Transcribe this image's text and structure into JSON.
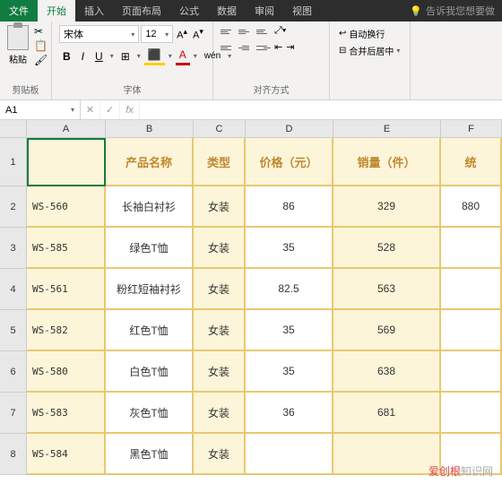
{
  "tabs": {
    "file": "文件",
    "home": "开始",
    "insert": "插入",
    "layout": "页面布局",
    "formulas": "公式",
    "data": "数据",
    "review": "审阅",
    "view": "视图",
    "tellme": "告诉我您想要做"
  },
  "ribbon": {
    "paste": "粘贴",
    "clipboard": "剪贴板",
    "font_name": "宋体",
    "font_size": "12",
    "bold": "B",
    "italic": "I",
    "underline": "U",
    "wen": "wén",
    "font": "字体",
    "wrap": "自动换行",
    "merge": "合并后居中",
    "align": "对齐方式"
  },
  "formula_bar": {
    "name": "A1",
    "fx": "fx"
  },
  "columns": [
    "A",
    "B",
    "C",
    "D",
    "E",
    "F"
  ],
  "rows": [
    "1",
    "2",
    "3",
    "4",
    "5",
    "6",
    "7",
    "8"
  ],
  "headers": {
    "a": "",
    "b": "产品名称",
    "c": "类型",
    "d": "价格（元）",
    "e": "销量（件）",
    "f": "统"
  },
  "data": [
    {
      "a": "WS-560",
      "b": "长袖白衬衫",
      "c": "女装",
      "d": "86",
      "e": "329",
      "f": "880"
    },
    {
      "a": "WS-585",
      "b": "绿色T恤",
      "c": "女装",
      "d": "35",
      "e": "528",
      "f": ""
    },
    {
      "a": "WS-561",
      "b": "粉红短袖衬衫",
      "c": "女装",
      "d": "82.5",
      "e": "563",
      "f": ""
    },
    {
      "a": "WS-582",
      "b": "红色T恤",
      "c": "女装",
      "d": "35",
      "e": "569",
      "f": ""
    },
    {
      "a": "WS-580",
      "b": "白色T恤",
      "c": "女装",
      "d": "35",
      "e": "638",
      "f": ""
    },
    {
      "a": "WS-583",
      "b": "灰色T恤",
      "c": "女装",
      "d": "36",
      "e": "681",
      "f": ""
    },
    {
      "a": "WS-584",
      "b": "黑色T恤",
      "c": "女装",
      "d": "",
      "e": "",
      "f": ""
    }
  ],
  "watermark": {
    "brand": "爱创根",
    "rest": "知识网"
  }
}
